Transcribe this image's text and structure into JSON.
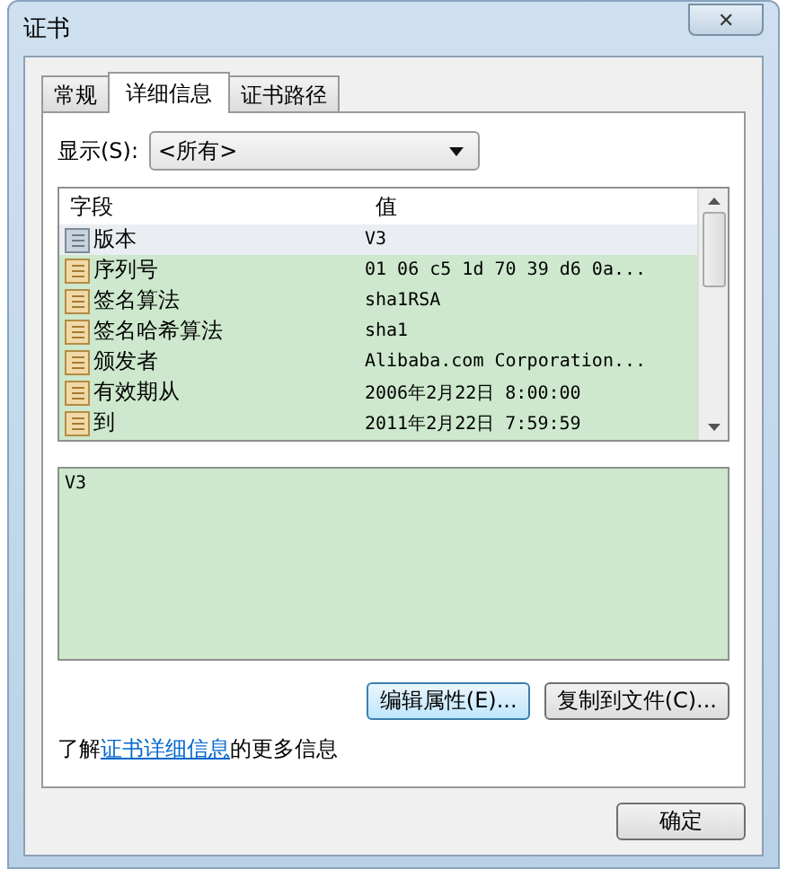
{
  "window": {
    "title": "证书",
    "close": "✕"
  },
  "tabs": [
    {
      "label": "常规",
      "selected": false
    },
    {
      "label": "详细信息",
      "selected": true
    },
    {
      "label": "证书路径",
      "selected": false
    }
  ],
  "show": {
    "label": "显示(S):",
    "value": "<所有>"
  },
  "table": {
    "columns": [
      "字段",
      "值"
    ],
    "rows": [
      {
        "field": "版本",
        "value": "V3",
        "selected": true
      },
      {
        "field": "序列号",
        "value": "01 06 c5 1d 70 39 d6 0a...",
        "selected": false
      },
      {
        "field": "签名算法",
        "value": "sha1RSA",
        "selected": false
      },
      {
        "field": "签名哈希算法",
        "value": "sha1",
        "selected": false
      },
      {
        "field": "颁发者",
        "value": "Alibaba.com Corporation...",
        "selected": false
      },
      {
        "field": "有效期从",
        "value": "2006年2月22日 8:00:00",
        "selected": false
      },
      {
        "field": "到",
        "value": "2011年2月22日 7:59:59",
        "selected": false
      }
    ]
  },
  "details": {
    "value": "V3"
  },
  "buttons": [
    "编辑属性(E)...",
    "复制到文件(C)..."
  ],
  "info": {
    "before": "了解",
    "link": "证书详细信息",
    "after": "的更多信息"
  },
  "ok": "确定"
}
